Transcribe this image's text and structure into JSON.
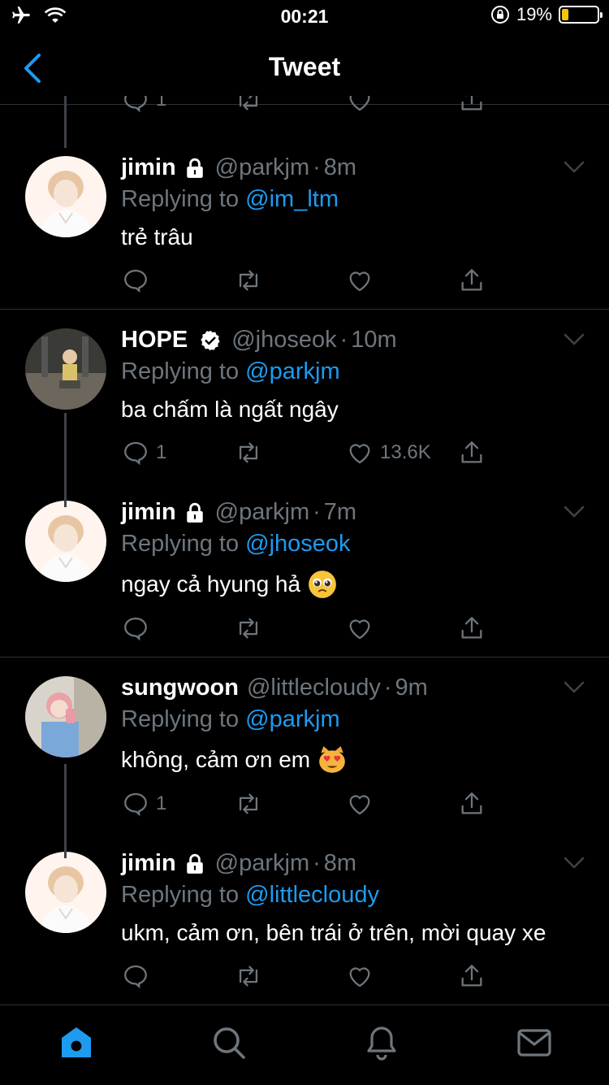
{
  "status_bar": {
    "time": "00:21",
    "battery_percent": "19%",
    "battery_level": 0.19,
    "icons": [
      "airplane-icon",
      "wifi-icon",
      "orientation-lock-icon",
      "battery-icon"
    ]
  },
  "nav": {
    "title": "Tweet",
    "back_icon": "chevron-left-icon"
  },
  "colors": {
    "accent": "#1d9bf0",
    "muted": "#6e767d",
    "background": "#000000",
    "divider": "#2f3336",
    "battery": "#f5c400"
  },
  "top_partial_actions": {
    "reply_count": "1"
  },
  "tweets": [
    {
      "name": "jimin",
      "protected": true,
      "verified": false,
      "handle": "@parkjm",
      "sep": "·",
      "time": "8m",
      "replying_prefix": "Replying to ",
      "replying_to": "@im_ltm",
      "text": "trẻ trâu",
      "reply_count": "",
      "like_count": ""
    },
    {
      "name": "HOPE",
      "protected": false,
      "verified": true,
      "handle": "@jhoseok",
      "sep": "·",
      "time": "10m",
      "replying_prefix": "Replying to ",
      "replying_to": "@parkjm",
      "text": "ba chấm là ngất ngây",
      "reply_count": "1",
      "like_count": "13.6K"
    },
    {
      "name": "jimin",
      "protected": true,
      "verified": false,
      "handle": "@parkjm",
      "sep": "·",
      "time": "7m",
      "replying_prefix": "Replying to ",
      "replying_to": "@jhoseok",
      "text": "ngay cả hyung hả",
      "emoji": "pleading-face-emoji",
      "reply_count": "",
      "like_count": ""
    },
    {
      "name": "sungwoon",
      "protected": false,
      "verified": false,
      "handle": "@littlecloudy",
      "sep": "·",
      "time": "9m",
      "replying_prefix": "Replying to ",
      "replying_to": "@parkjm",
      "text": "không, cảm ơn em",
      "emoji": "heart-eyes-cat-emoji",
      "reply_count": "1",
      "like_count": ""
    },
    {
      "name": "jimin",
      "protected": true,
      "verified": false,
      "handle": "@parkjm",
      "sep": "·",
      "time": "8m",
      "replying_prefix": "Replying to ",
      "replying_to": "@littlecloudy",
      "text": "ukm, cảm ơn, bên trái ở trên, mời quay xe",
      "reply_count": "",
      "like_count": ""
    }
  ],
  "tab_bar": {
    "items": [
      "home-icon",
      "search-icon",
      "notifications-icon",
      "messages-icon"
    ],
    "active": "home-icon"
  }
}
